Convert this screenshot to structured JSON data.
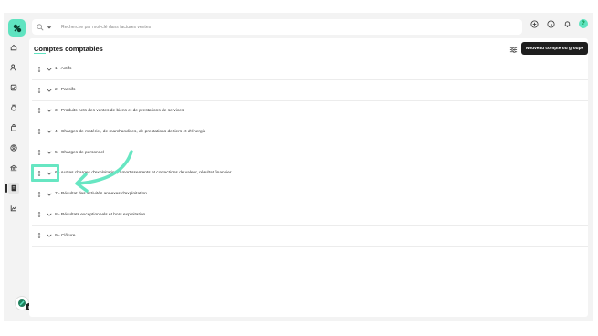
{
  "search": {
    "placeholder": "Recherche par mot-clé dans factures ventes"
  },
  "page": {
    "title": "Comptes comptables",
    "primary_button": "Nouveau compte ou groupe"
  },
  "accounts": [
    {
      "label": "1 - Actifs"
    },
    {
      "label": "2 - Passifs"
    },
    {
      "label": "3 - Produits nets des ventes de biens et de prestations de services"
    },
    {
      "label": "4 - Charges de matériel, de marchandises, de prestations de tiers et d'énergie"
    },
    {
      "label": "5 - Charges de personnel"
    },
    {
      "label": "6 - Autres charges d'exploitation, amortissements et corrections de valeur, résultat financier"
    },
    {
      "label": "7 - Résultat des activités annexes d'exploitation"
    },
    {
      "label": "8 - Résultats exceptionnels et hors exploitation"
    },
    {
      "label": "9 - Clôture"
    }
  ],
  "user": {
    "notification_count": "8"
  },
  "colors": {
    "accent": "#5fe3c0",
    "dark": "#1e1e1e",
    "background": "#f3f3f3"
  },
  "icons": {
    "nav": [
      "home-icon",
      "user-dollar-icon",
      "checklist-icon",
      "money-bag-icon",
      "shopping-bag-icon",
      "contact-icon",
      "bank-icon",
      "ledger-icon",
      "chart-icon"
    ],
    "top": [
      "plus-circle-icon",
      "clock-icon",
      "bell-icon",
      "help-icon"
    ]
  }
}
